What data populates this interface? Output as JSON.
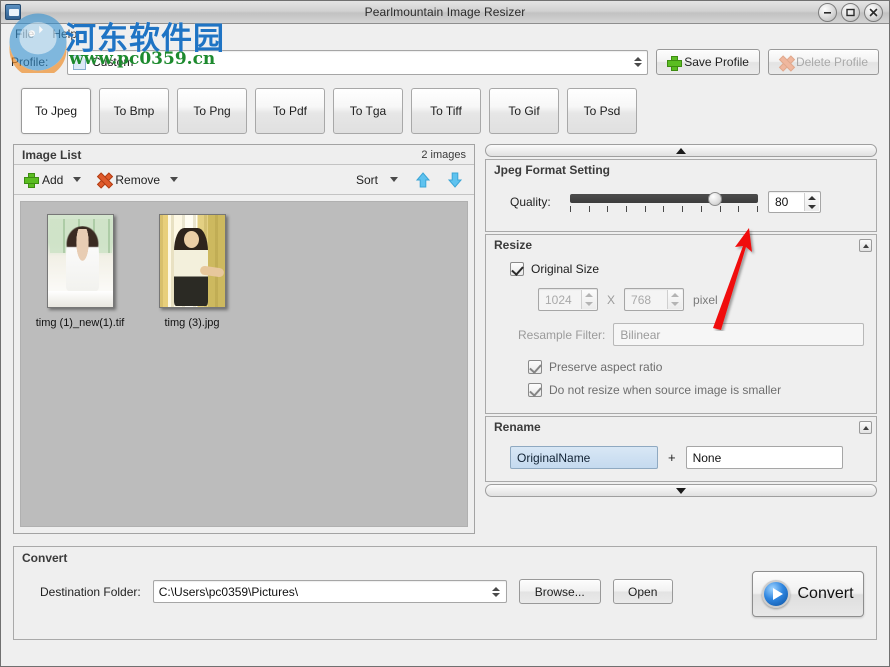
{
  "window": {
    "title": "Pearlmountain Image Resizer",
    "minimize_label": "–",
    "maximize_label": "□",
    "close_label": "×"
  },
  "menubar": {
    "items": [
      {
        "label": "File"
      },
      {
        "label": "Help"
      }
    ]
  },
  "watermark": {
    "cn_text": "河东软件园",
    "url_text": "www.pc0359.cn",
    "cn_color": "#1f74c4",
    "url_color": "#1d8a2e"
  },
  "profile": {
    "label": "Profile:",
    "value": "Custom",
    "save_label": "Save Profile",
    "delete_label": "Delete Profile",
    "delete_disabled": true
  },
  "format_tabs": {
    "active": "To Jpeg",
    "items": [
      {
        "label": "To Jpeg"
      },
      {
        "label": "To Bmp"
      },
      {
        "label": "To Png"
      },
      {
        "label": "To Pdf"
      },
      {
        "label": "To Tga"
      },
      {
        "label": "To Tiff"
      },
      {
        "label": "To Gif"
      },
      {
        "label": "To Psd"
      }
    ]
  },
  "image_list": {
    "title": "Image List",
    "count_label": "2 images",
    "toolbar": {
      "add_label": "Add",
      "remove_label": "Remove",
      "sort_label": "Sort",
      "move_up_label": "Move Up",
      "move_down_label": "Move Down"
    },
    "thumbnails": [
      {
        "filename": "timg (1)_new(1).tif"
      },
      {
        "filename": "timg (3).jpg"
      }
    ]
  },
  "jpeg_setting": {
    "title": "Jpeg Format Setting",
    "quality_label": "Quality:",
    "quality_value": "80",
    "quality_min": 0,
    "quality_max": 100,
    "tick_count": 11
  },
  "resize": {
    "title": "Resize",
    "original_size_label": "Original Size",
    "original_size_checked": true,
    "width_value": "1024",
    "height_value": "768",
    "x_label": "X",
    "unit_label": "pixel",
    "resample_label": "Resample Filter:",
    "resample_value": "Bilinear",
    "preserve_aspect_label": "Preserve aspect ratio",
    "preserve_aspect_checked": true,
    "no_upscale_label": "Do not resize when source image is smaller",
    "no_upscale_checked": true
  },
  "rename": {
    "title": "Rename",
    "first_value": "OriginalName",
    "plus_label": "+",
    "second_value": "None"
  },
  "convert": {
    "title": "Convert",
    "destination_label": "Destination Folder:",
    "destination_value": "C:\\Users\\pc0359\\Pictures\\",
    "browse_label": "Browse...",
    "open_label": "Open",
    "convert_label": "Convert"
  },
  "annotation": {
    "arrow_color": "#f01010"
  }
}
